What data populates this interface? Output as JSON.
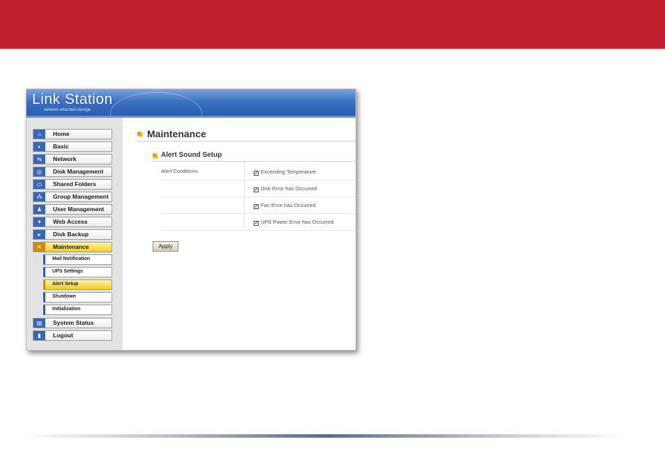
{
  "app": {
    "logo_text": "Link Station",
    "logo_tagline": "network attached storage"
  },
  "colors": {
    "banner": "#c1202f",
    "header_blue": "#3c72c2",
    "active_yellow": "#f1cf22"
  },
  "sidebar": {
    "items": [
      {
        "label": "Home",
        "icon": "home-icon"
      },
      {
        "label": "Basic",
        "icon": "basic-icon"
      },
      {
        "label": "Network",
        "icon": "network-icon"
      },
      {
        "label": "Disk Management",
        "icon": "disk-icon"
      },
      {
        "label": "Shared Folders",
        "icon": "folder-icon"
      },
      {
        "label": "Group Management",
        "icon": "group-icon"
      },
      {
        "label": "User Management",
        "icon": "user-icon"
      },
      {
        "label": "Web Access",
        "icon": "web-icon"
      },
      {
        "label": "Disk Backup",
        "icon": "backup-icon"
      },
      {
        "label": "Maintenance",
        "icon": "tools-icon"
      },
      {
        "label": "System Status",
        "icon": "status-icon"
      },
      {
        "label": "Logout",
        "icon": "logout-icon"
      }
    ],
    "subitems": [
      {
        "label": "Mail Notification"
      },
      {
        "label": "UPS Settings"
      },
      {
        "label": "Alert Setup"
      },
      {
        "label": "Shutdown"
      },
      {
        "label": "Initialization"
      }
    ],
    "active_item": "Maintenance",
    "active_subitem": "Alert Setup"
  },
  "main": {
    "title": "Maintenance",
    "section_title": "Alert Sound Setup",
    "conditions_label": "Alert Conditions",
    "options": [
      {
        "label": "Exceeding Temperature",
        "checked": true
      },
      {
        "label": "Disk Error has Occurred",
        "checked": true
      },
      {
        "label": "Fan Error has Occurred",
        "checked": true
      },
      {
        "label": "UPS Power Error has Occurred",
        "checked": true
      }
    ],
    "apply_label": "Apply",
    "check_mark": "✓"
  }
}
